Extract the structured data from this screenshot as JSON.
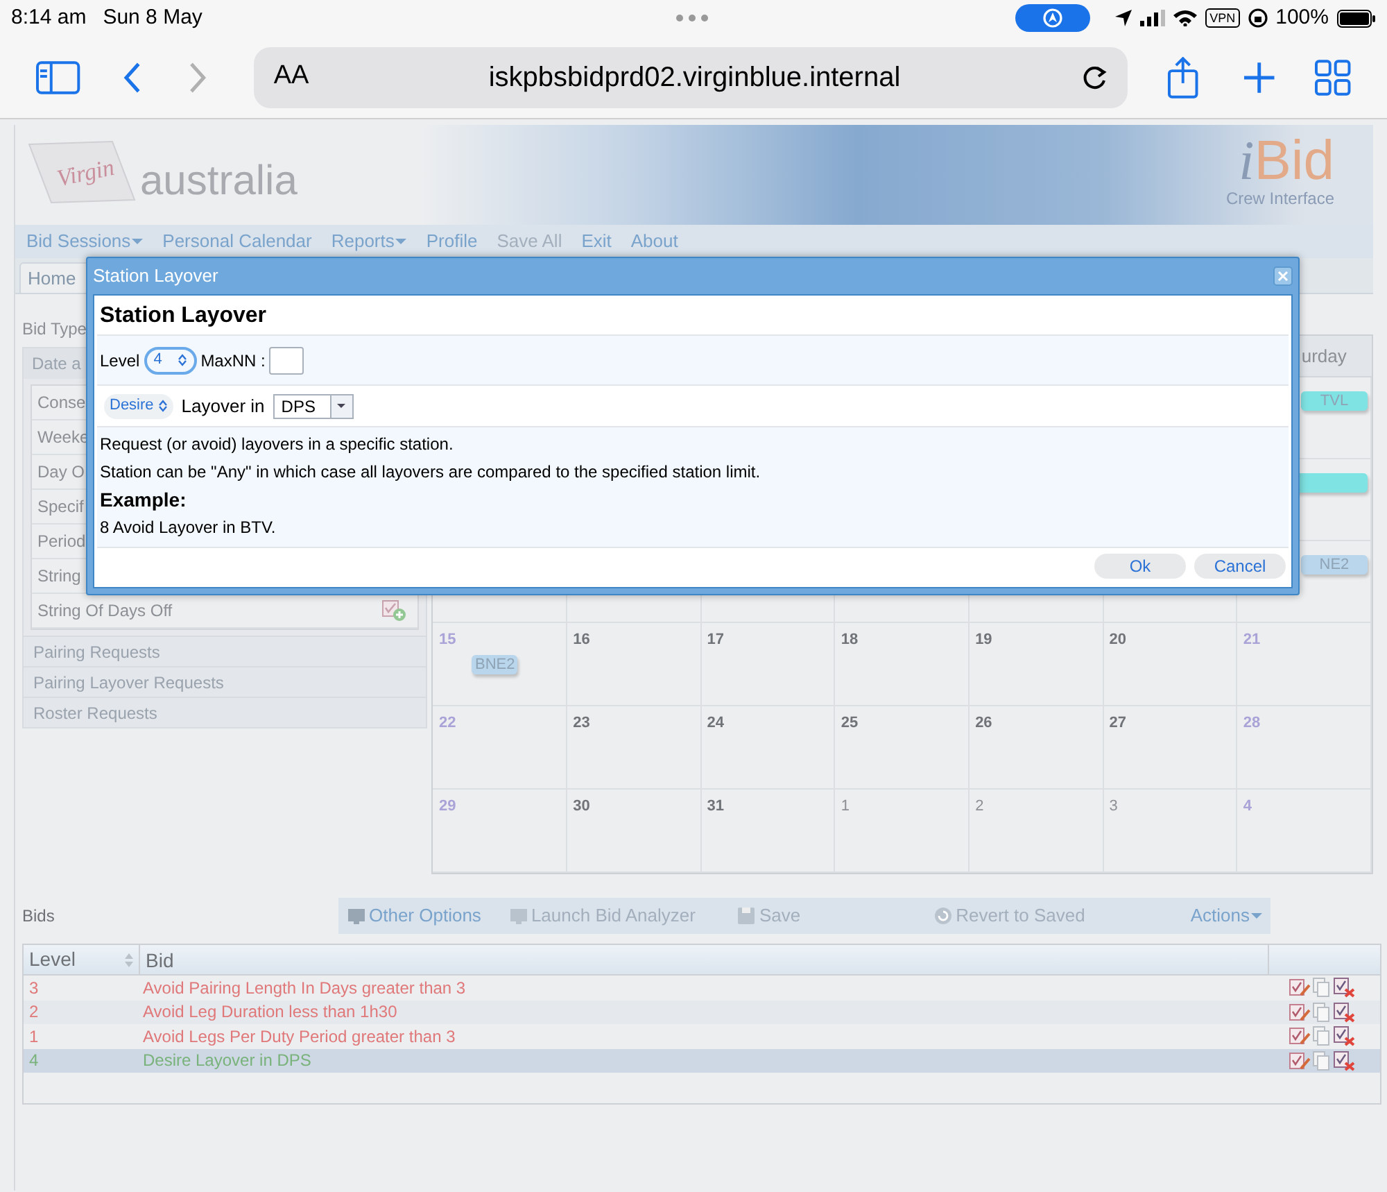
{
  "status_bar": {
    "time": "8:14 am",
    "date": "Sun 8 May",
    "vpn": "VPN",
    "battery": "100%"
  },
  "browser": {
    "text_size": "AA",
    "url": "iskpbsbidprd02.virginblue.internal"
  },
  "banner": {
    "logo_script": "Virgin",
    "logo_word": "australia",
    "app_name": "Bid",
    "app_prefix": "i",
    "app_subtitle": "Crew Interface"
  },
  "menu": [
    {
      "label": "Bid Sessions",
      "dropdown": true,
      "disabled": false
    },
    {
      "label": "Personal Calendar",
      "dropdown": false,
      "disabled": false
    },
    {
      "label": "Reports",
      "dropdown": true,
      "disabled": false
    },
    {
      "label": "Profile",
      "dropdown": false,
      "disabled": false
    },
    {
      "label": "Save All",
      "dropdown": false,
      "disabled": true
    },
    {
      "label": "Exit",
      "dropdown": false,
      "disabled": false
    },
    {
      "label": "About",
      "dropdown": false,
      "disabled": false
    }
  ],
  "tabs": [
    {
      "label": "Home"
    }
  ],
  "bid_types": {
    "label": "Bid Type",
    "open_section": "Date a",
    "items": [
      "Conse",
      "Weeke",
      "Day O",
      "Specif",
      "Period",
      "String",
      "String Of Days Off"
    ],
    "sections": [
      "Pairing Requests",
      "Pairing Layover Requests",
      "Roster Requests"
    ]
  },
  "calendar": {
    "header": "urday",
    "top_weeks": [
      {
        "chip": {
          "text": "TVL",
          "color": "#7fe3e3"
        }
      },
      {
        "chip": {
          "color": "#7fe3e3"
        }
      },
      {
        "chip": {
          "text": "NE2",
          "color": "#b9d6ec"
        }
      }
    ],
    "weeks": [
      [
        {
          "day": "15",
          "kind": "weekend",
          "chip": {
            "text": "BNE2",
            "color": "#b9d6ec"
          }
        },
        {
          "day": "16",
          "kind": "weekday"
        },
        {
          "day": "17",
          "kind": "weekday"
        },
        {
          "day": "18",
          "kind": "weekday"
        },
        {
          "day": "19",
          "kind": "weekday"
        },
        {
          "day": "20",
          "kind": "weekday"
        },
        {
          "day": "21",
          "kind": "weekend"
        }
      ],
      [
        {
          "day": "22",
          "kind": "weekend"
        },
        {
          "day": "23",
          "kind": "weekday"
        },
        {
          "day": "24",
          "kind": "weekday"
        },
        {
          "day": "25",
          "kind": "weekday"
        },
        {
          "day": "26",
          "kind": "weekday"
        },
        {
          "day": "27",
          "kind": "weekday"
        },
        {
          "day": "28",
          "kind": "weekend"
        }
      ],
      [
        {
          "day": "29",
          "kind": "weekend"
        },
        {
          "day": "30",
          "kind": "weekday"
        },
        {
          "day": "31",
          "kind": "weekday"
        },
        {
          "day": "1",
          "kind": "other_month"
        },
        {
          "day": "2",
          "kind": "other_month"
        },
        {
          "day": "3",
          "kind": "other_month"
        },
        {
          "day": "4",
          "kind": "weekend"
        }
      ]
    ]
  },
  "dialog": {
    "title": "Station Layover",
    "heading": "Station Layover",
    "level_label": "Level",
    "level_value": "4",
    "maxnn_label": "MaxNN :",
    "preference": "Desire",
    "layover_label": "Layover in",
    "station": "DPS",
    "description": [
      {
        "kind": "text",
        "text": "Request (or avoid) layovers in a specific station."
      },
      {
        "kind": "text",
        "text": "Station can be \"Any\" in which case all layovers are compared to the specified station limit."
      },
      {
        "kind": "heading",
        "text": "Example:"
      },
      {
        "kind": "text",
        "text": "8 Avoid Layover in BTV."
      }
    ],
    "buttons": [
      "Ok",
      "Cancel"
    ]
  },
  "bids": {
    "label": "Bids",
    "toolbar": [
      {
        "label": "Other Options",
        "disabled": false
      },
      {
        "label": "Launch Bid Analyzer",
        "disabled": true
      },
      {
        "label": "Save",
        "disabled": true
      },
      {
        "label": "Revert to Saved",
        "disabled": true
      }
    ],
    "actions": "Actions",
    "columns": [
      "Level",
      "Bid"
    ],
    "rows": [
      {
        "level": "3",
        "bid": "Avoid Pairing Length In Days greater than 3",
        "kind": "avoid",
        "selected": false
      },
      {
        "level": "2",
        "bid": "Avoid Leg Duration less than 1h30",
        "kind": "avoid",
        "selected": false
      },
      {
        "level": "1",
        "bid": "Avoid Legs Per Duty Period greater than 3",
        "kind": "avoid",
        "selected": false
      },
      {
        "level": "4",
        "bid": "Desire Layover in DPS",
        "kind": "desire",
        "selected": true
      }
    ]
  }
}
